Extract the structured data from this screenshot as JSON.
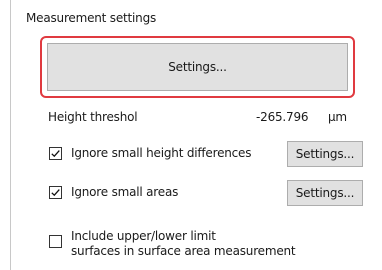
{
  "panel": {
    "title": "Measurement settings"
  },
  "main_button": {
    "label": "Settings...",
    "highlight_color": "#e03a40"
  },
  "height_threshold": {
    "label": "Height threshol",
    "value": "-265.796",
    "unit": "μm"
  },
  "options": [
    {
      "label": "Ignore small height differences",
      "checked": true,
      "button_label": "Settings..."
    },
    {
      "label": "Ignore small areas",
      "checked": true,
      "button_label": "Settings..."
    },
    {
      "label_line1": "Include upper/lower limit",
      "label_line2": "surfaces in surface area measurement",
      "checked": false
    }
  ]
}
